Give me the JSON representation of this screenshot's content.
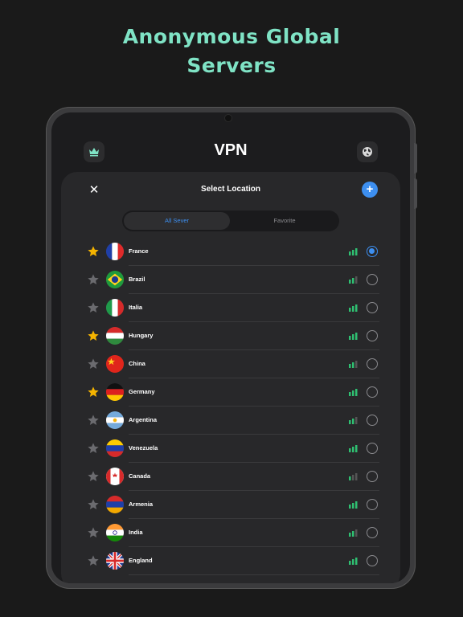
{
  "promo": {
    "line1": "Anonymous Global",
    "line2": "Servers"
  },
  "app": {
    "title": "VPN",
    "left_icon": "crown-icon",
    "right_icon": "globe-icon"
  },
  "sheet": {
    "close_label": "✕",
    "title": "Select Location",
    "add_label": "+",
    "tabs": [
      {
        "label": "All Sever",
        "active": true
      },
      {
        "label": "Favorite",
        "active": false
      }
    ]
  },
  "colors": {
    "accent": "#3d8ff0",
    "promo": "#7fe3c5",
    "signal_on": "#2fbf71",
    "star_on": "#f5b400",
    "star_off": "#6b6b6f"
  },
  "servers": [
    {
      "name": "France",
      "favorite": true,
      "signal": 3,
      "selected": true,
      "flag": "france"
    },
    {
      "name": "Brazil",
      "favorite": false,
      "signal": 2,
      "selected": false,
      "flag": "brazil"
    },
    {
      "name": "Italia",
      "favorite": false,
      "signal": 3,
      "selected": false,
      "flag": "italy"
    },
    {
      "name": "Hungary",
      "favorite": true,
      "signal": 3,
      "selected": false,
      "flag": "hungary"
    },
    {
      "name": "China",
      "favorite": false,
      "signal": 2,
      "selected": false,
      "flag": "china"
    },
    {
      "name": "Germany",
      "favorite": true,
      "signal": 3,
      "selected": false,
      "flag": "germany"
    },
    {
      "name": "Argentina",
      "favorite": false,
      "signal": 2,
      "selected": false,
      "flag": "argentina"
    },
    {
      "name": "Venezuela",
      "favorite": false,
      "signal": 3,
      "selected": false,
      "flag": "venezuela"
    },
    {
      "name": "Canada",
      "favorite": false,
      "signal": 1,
      "selected": false,
      "flag": "canada"
    },
    {
      "name": "Armenia",
      "favorite": false,
      "signal": 3,
      "selected": false,
      "flag": "armenia"
    },
    {
      "name": "India",
      "favorite": false,
      "signal": 2,
      "selected": false,
      "flag": "india"
    },
    {
      "name": "England",
      "favorite": false,
      "signal": 3,
      "selected": false,
      "flag": "england"
    }
  ]
}
